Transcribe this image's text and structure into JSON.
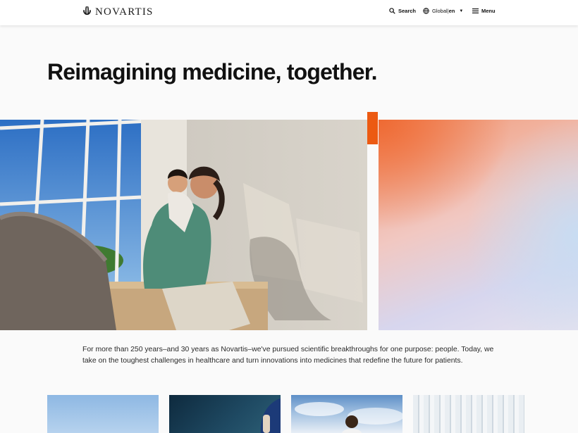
{
  "header": {
    "brand": "NOVARTIS",
    "search_label": "Search",
    "region_label": "Global",
    "separator": "|",
    "language_label": "en",
    "menu_label": "Menu"
  },
  "hero": {
    "headline_regular": "Reimagining medicine, ",
    "headline_bold": "together",
    "headline_end": "."
  },
  "intro": {
    "text": "For more than 250 years–and 30 years as Novartis–we've pursued scientific breakthroughs for one purpose: people. Today, we take on the toughest challenges in healthcare and turn innovations into medicines that redefine the future for patients."
  },
  "colors": {
    "accent": "#ec5a12",
    "text": "#111111",
    "background": "#fafafa"
  },
  "icons": [
    "novartis-logo-icon",
    "search-icon",
    "globe-icon",
    "caret-down-icon",
    "hamburger-menu-icon"
  ]
}
